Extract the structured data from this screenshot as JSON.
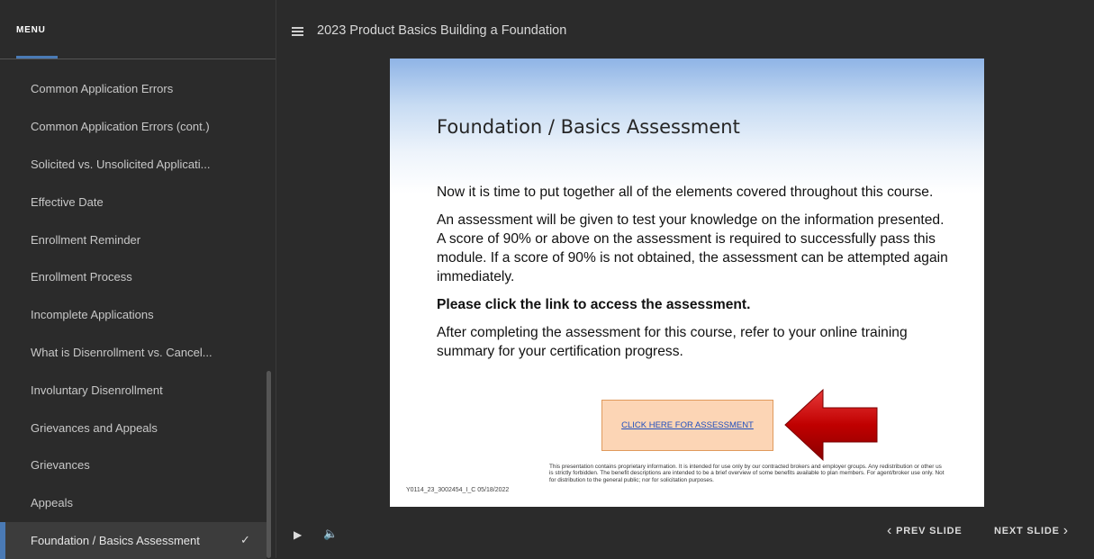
{
  "sidebar": {
    "header": "MENU",
    "items": [
      {
        "label": "Common Application Errors"
      },
      {
        "label": "Common Application Errors (cont.)"
      },
      {
        "label": "Solicited vs. Unsolicited Applicati..."
      },
      {
        "label": "Effective Date"
      },
      {
        "label": "Enrollment Reminder"
      },
      {
        "label": "Enrollment Process"
      },
      {
        "label": "Incomplete Applications"
      },
      {
        "label": "What is Disenrollment vs. Cancel..."
      },
      {
        "label": "Involuntary Disenrollment"
      },
      {
        "label": "Grievances and Appeals"
      },
      {
        "label": "Grievances"
      },
      {
        "label": "Appeals"
      },
      {
        "label": "Foundation / Basics Assessment",
        "active": true,
        "check": "✓"
      }
    ]
  },
  "header": {
    "course_title": "2023 Product Basics Building a Foundation"
  },
  "slide": {
    "title": "Foundation / Basics Assessment",
    "paragraphs": [
      "Now it is time to put together all of the elements covered throughout this course.",
      "An assessment will be given to test your knowledge on the information presented.  A score of 90% or above on the assessment is required to successfully pass this module.  If a score of 90% is not obtained, the assessment can be attempted again immediately.",
      "Please click the link to access the assessment.",
      "After completing the assessment for this course, refer to your online training summary for your certification progress."
    ],
    "assessment_link": "CLICK HERE FOR ASSESSMENT",
    "doc_code": "Y0114_23_3002454_I_C 05/18/2022",
    "disclaimer": "This presentation contains proprietary information.  It is intended for use only by our contracted brokers and employer groups.  Any redistribution or other us is strictly forbidden.  The benefit descriptions are intended to be a brief overview of some benefits available to plan members. For agent/broker use only. Not for distribution to the general public; nor for solicitation purposes."
  },
  "controls": {
    "prev_label": "PREV SLIDE",
    "next_label": "NEXT SLIDE"
  },
  "colors": {
    "accent": "#4a7ab5",
    "background": "#2b2b2b",
    "box_fill": "#fcd5b5",
    "arrow": "#c00000"
  },
  "icons": [
    "hamburger-icon",
    "check-icon",
    "play-icon",
    "volume-icon",
    "chevron-left-icon",
    "chevron-right-icon",
    "red-arrow-icon"
  ]
}
